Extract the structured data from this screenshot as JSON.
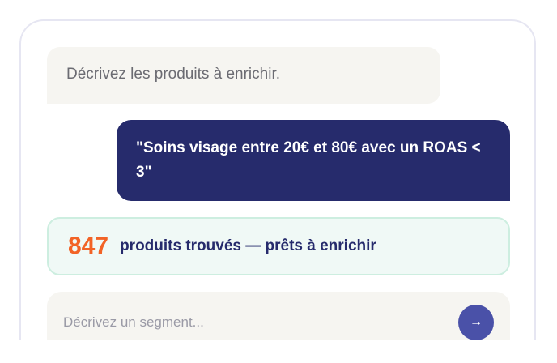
{
  "chat": {
    "system_prompt": "Décrivez les produits à enrichir.",
    "user_message": "\"Soins visage entre 20€ et 80€ avec un ROAS < 3\""
  },
  "result": {
    "count": "847",
    "text": "produits trouvés — prêts à enrichir"
  },
  "composer": {
    "placeholder": "Décrivez un segment...",
    "send_icon": "→"
  },
  "colors": {
    "user_bubble": "#262b6c",
    "count_accent": "#f26326",
    "send_button": "#4a51a8",
    "result_bg": "#f0f9f6"
  }
}
